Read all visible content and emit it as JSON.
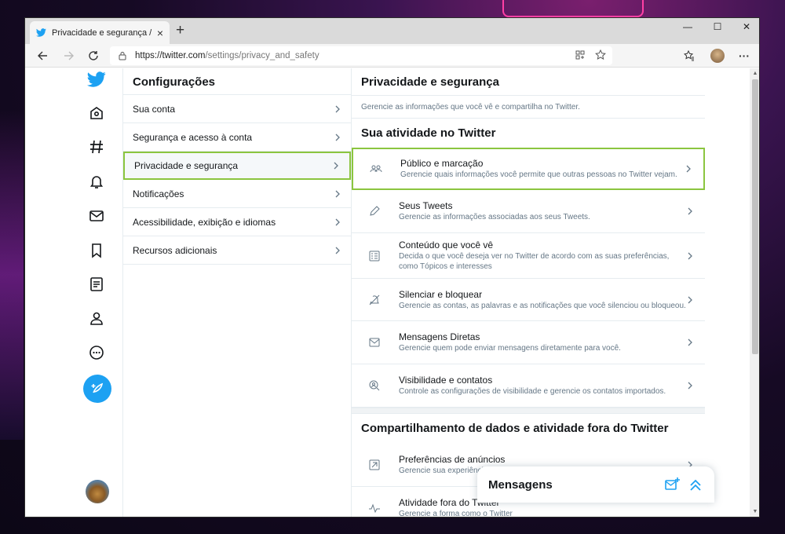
{
  "browser": {
    "tab_title": "Privacidade e segurança / Twitter",
    "url_host": "https://twitter.com",
    "url_path": "/settings/privacy_and_safety",
    "new_tab": "+",
    "tab_close": "×"
  },
  "window_controls": {
    "minimize": "—",
    "maximize": "☐",
    "close": "✕"
  },
  "settings": {
    "title": "Configurações",
    "items": [
      {
        "label": "Sua conta"
      },
      {
        "label": "Segurança e acesso à conta"
      },
      {
        "label": "Privacidade e segurança"
      },
      {
        "label": "Notificações"
      },
      {
        "label": "Acessibilidade, exibição e idiomas"
      },
      {
        "label": "Recursos adicionais"
      }
    ]
  },
  "detail": {
    "title": "Privacidade e segurança",
    "description": "Gerencie as informações que você vê e compartilha no Twitter.",
    "section1_title": "Sua atividade no Twitter",
    "section1_items": [
      {
        "title": "Público e marcação",
        "subtitle": "Gerencie quais informações você permite que outras pessoas no Twitter vejam.",
        "icon": "people-icon"
      },
      {
        "title": "Seus Tweets",
        "subtitle": "Gerencie as informações associadas aos seus Tweets.",
        "icon": "pencil-icon"
      },
      {
        "title": "Conteúdo que você vê",
        "subtitle": "Decida o que você deseja ver no Twitter de acordo com as suas preferências, como Tópicos e interesses",
        "icon": "content-list-icon"
      },
      {
        "title": "Silenciar e bloquear",
        "subtitle": "Gerencie as contas, as palavras e as notificações que você silenciou ou bloqueou.",
        "icon": "mute-icon"
      },
      {
        "title": "Mensagens Diretas",
        "subtitle": "Gerencie quem pode enviar mensagens diretamente para você.",
        "icon": "envelope-icon"
      },
      {
        "title": "Visibilidade e contatos",
        "subtitle": "Controle as configurações de visibilidade e gerencie os contatos importados.",
        "icon": "search-person-icon"
      }
    ],
    "section2_title": "Compartilhamento de dados e atividade fora do Twitter",
    "section2_items": [
      {
        "title": "Preferências de anúncios",
        "subtitle": "Gerencie sua experiência com anúncios no Twitter.",
        "icon": "ad-arrow-icon"
      },
      {
        "title": "Atividade fora do Twitter",
        "subtitle": "Gerencie a forma como o Twitter",
        "icon": "activity-icon"
      }
    ]
  },
  "messages_dock": {
    "title": "Mensagens"
  },
  "colors": {
    "twitter_blue": "#1da1f2",
    "highlight_green": "#8bc53f"
  }
}
